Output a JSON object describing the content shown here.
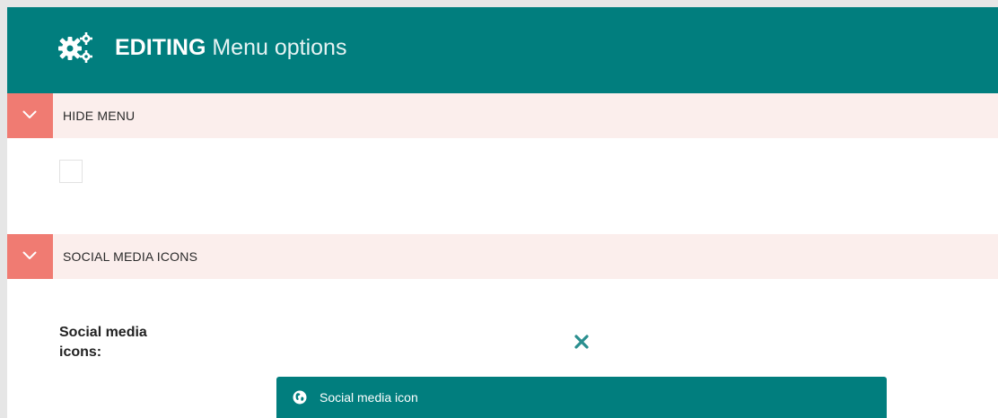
{
  "header": {
    "icon": "cogs-icon",
    "title_strong": "EDITING",
    "title_rest": "Menu options"
  },
  "sections": [
    {
      "label": "HIDE MENU",
      "toggle_icon": "chevron-down-icon"
    },
    {
      "label": "SOCIAL MEDIA ICONS",
      "toggle_icon": "chevron-down-icon"
    }
  ],
  "hide_menu": {
    "checked": false
  },
  "social_media": {
    "field_label": "Social media icons:",
    "remove_icon": "close-icon",
    "item": {
      "icon": "globe-icon",
      "label": "Social media icon"
    }
  },
  "colors": {
    "primary": "#017e7e",
    "toggle": "#f07b72",
    "section_bg": "#fbeeec",
    "remove": "#2a8f8f"
  }
}
